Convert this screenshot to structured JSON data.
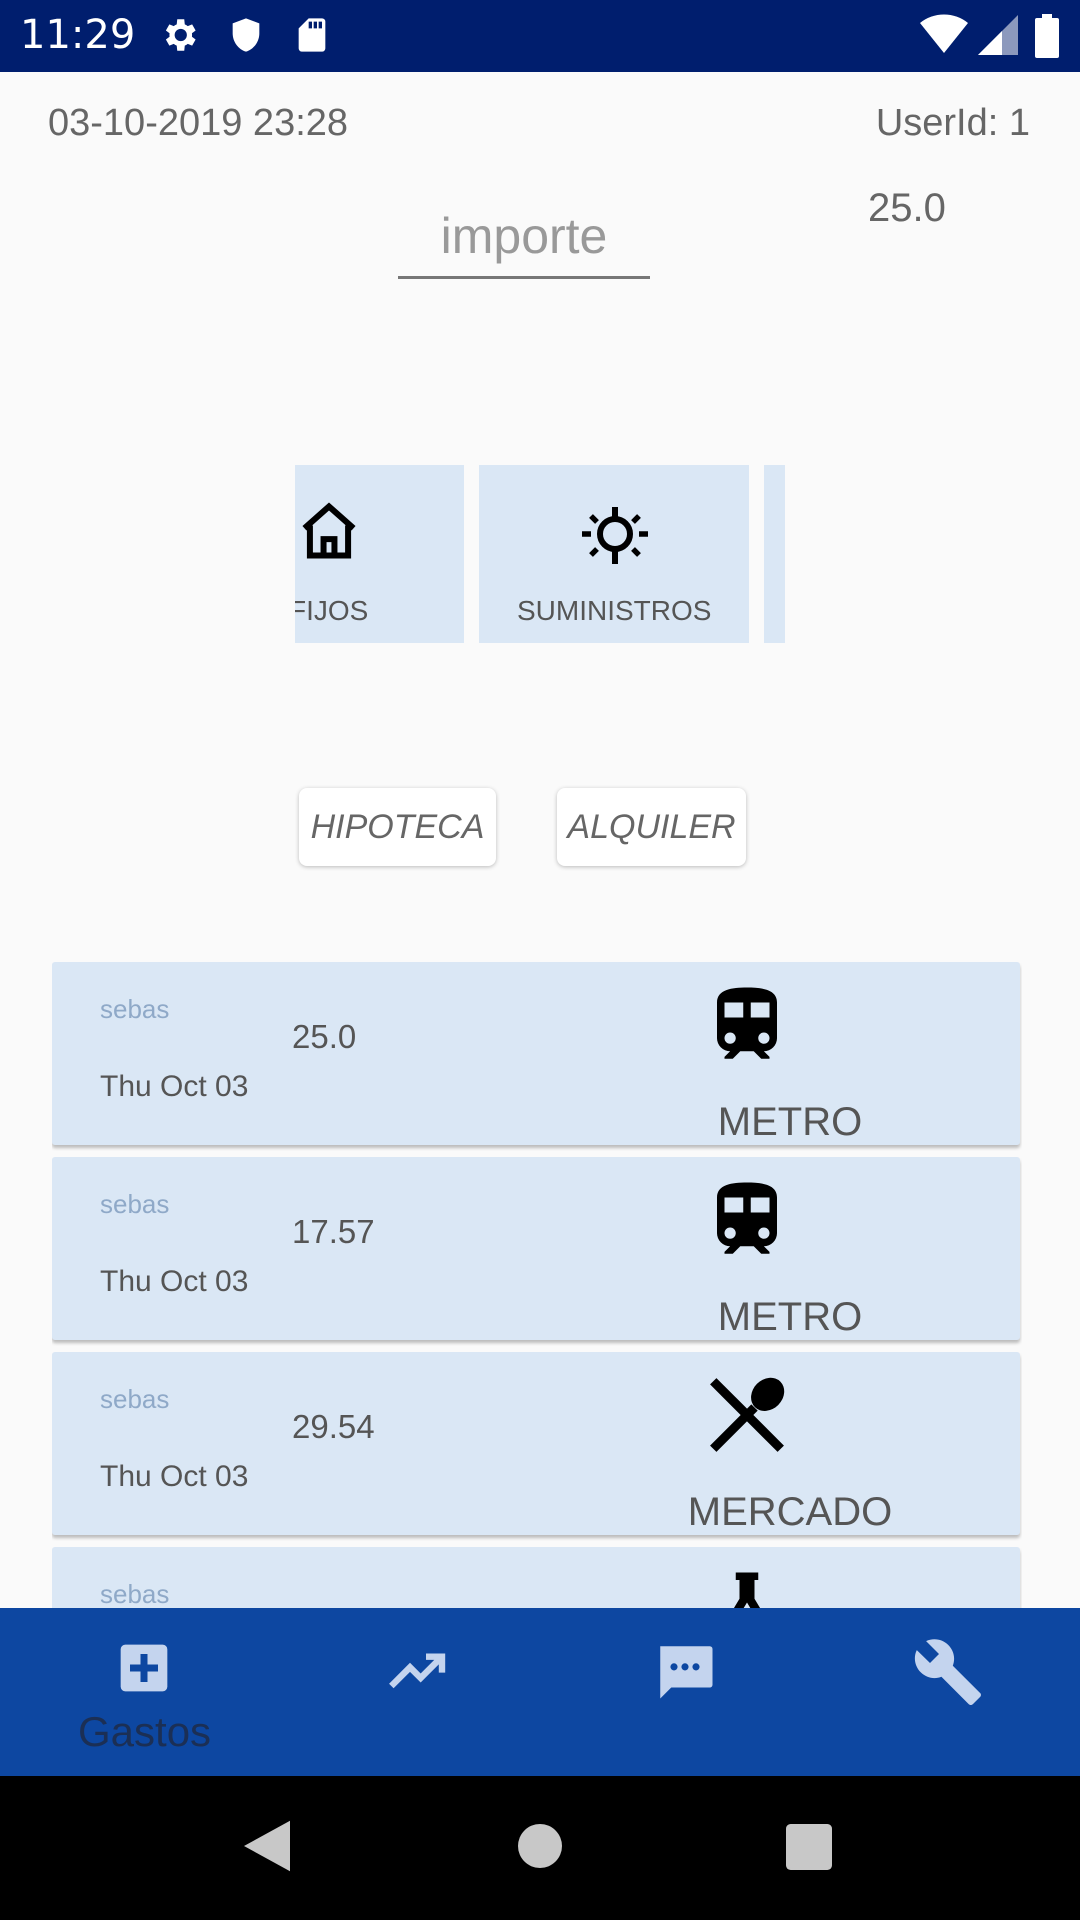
{
  "status_bar": {
    "time": "11:29",
    "icons": [
      "gear-icon",
      "shield-icon",
      "sd-card-icon",
      "wifi-icon",
      "signal-icon",
      "battery-icon"
    ]
  },
  "header": {
    "datetime": "03-10-2019 23:28",
    "user_id": "UserId: 1",
    "total": "25.0"
  },
  "amount_input": {
    "placeholder": "importe"
  },
  "categories": [
    {
      "label": "FIJOS",
      "icon": "house-icon"
    },
    {
      "label": "SUMINISTROS",
      "icon": "lightbulb-icon"
    }
  ],
  "subcategories": [
    "HIPOTECA",
    "ALQUILER"
  ],
  "expenses": [
    {
      "user": "sebas",
      "date": "Thu Oct 03",
      "amount": "25.0",
      "category": "METRO",
      "icon": "train-icon"
    },
    {
      "user": "sebas",
      "date": "Thu Oct 03",
      "amount": "17.57",
      "category": "METRO",
      "icon": "train-icon"
    },
    {
      "user": "sebas",
      "date": "Thu Oct 03",
      "amount": "29.54",
      "category": "MERCADO",
      "icon": "utensils-icon"
    },
    {
      "user": "sebas",
      "date": "",
      "amount": "",
      "category": "",
      "icon": "flask-icon"
    }
  ],
  "bottom_nav": {
    "items": [
      {
        "label": "Gastos",
        "icon": "add-box-icon"
      },
      {
        "label": "",
        "icon": "trending-up-icon"
      },
      {
        "label": "",
        "icon": "message-icon"
      },
      {
        "label": "",
        "icon": "wrench-icon"
      }
    ]
  },
  "colors": {
    "status_bar": "#001e6e",
    "bottom_bar": "#0d47a1",
    "card": "#dae7f5"
  }
}
